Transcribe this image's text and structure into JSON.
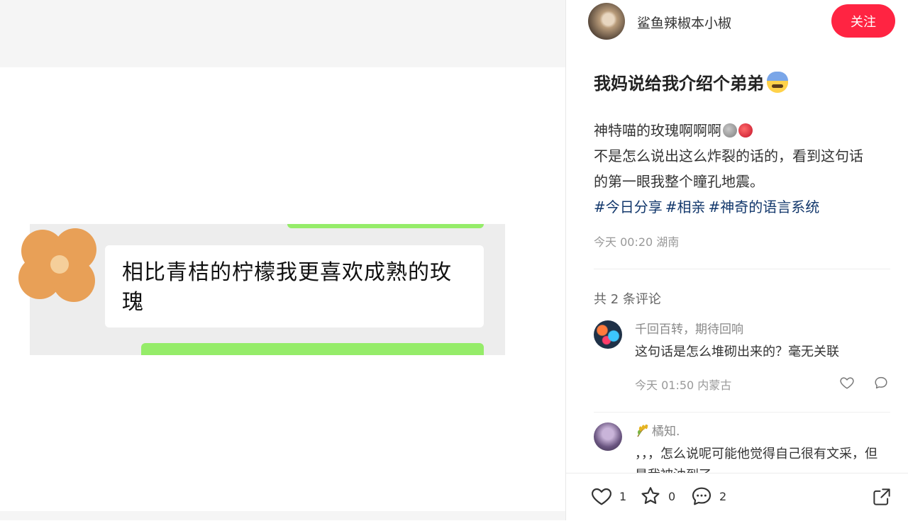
{
  "image": {
    "bubble_text": "相比青桔的柠檬我更喜欢成熟的玫瑰"
  },
  "author": {
    "name": "鲨鱼辣椒本小椒",
    "follow_label": "关注"
  },
  "post": {
    "title": "我妈说给我介绍个弟弟",
    "title_emoji": "anxious-sweat-emoji",
    "body_line1": "神特喵的玫瑰啊啊啊",
    "body_line1_emojis": [
      "stone-emoji",
      "rose-emoji"
    ],
    "body_line2": "不是怎么说出这么炸裂的话的，看到这句话",
    "body_line3": "的第一眼我整个瞳孔地震。",
    "hashtags": [
      "#今日分享",
      "#相亲",
      "#神奇的语言系统"
    ],
    "meta": "今天 00:20 湖南"
  },
  "comments_header": "共 2 条评论",
  "comments": [
    {
      "author": "千回百转，期待回响",
      "text": "这句话是怎么堆砌出来的？毫无关联",
      "meta": "今天 01:50 内蒙古"
    },
    {
      "author": "橘知.",
      "author_icon": "rice-stalk-icon",
      "text": "，，，怎么说呢可能他觉得自己很有文采，但是我被油到了"
    }
  ],
  "bottom_bar": {
    "likes": "1",
    "stars": "0",
    "comments": "2"
  },
  "colors": {
    "accent": "#ff2442",
    "hashtag": "#13386c",
    "chat_green": "#95ec69"
  }
}
